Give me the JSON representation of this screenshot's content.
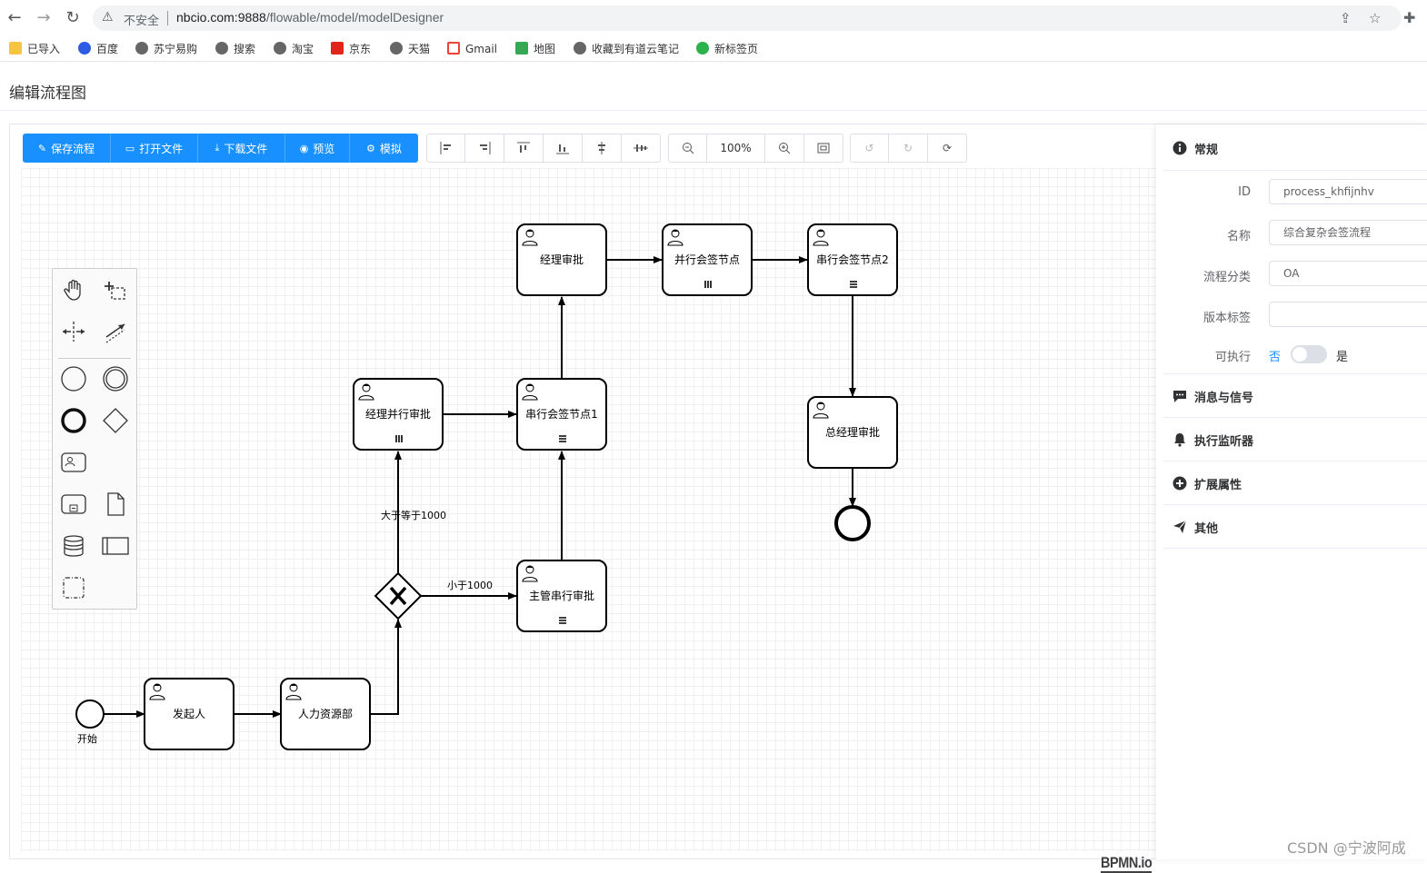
{
  "browser": {
    "insecure_label": "不安全",
    "url_host": "nbcio.com:9888",
    "url_path": "/flowable/model/modelDesigner"
  },
  "bookmarks": [
    "已导入",
    "百度",
    "苏宁易购",
    "搜索",
    "淘宝",
    "京东",
    "天猫",
    "Gmail",
    "地图",
    "收藏到有道云笔记",
    "新标签页"
  ],
  "page": {
    "title": "编辑流程图"
  },
  "toolbar": {
    "primary": [
      "保存流程",
      "打开文件",
      "下载文件",
      "预览",
      "模拟"
    ],
    "zoom": "100%"
  },
  "diagram": {
    "start_label": "开始",
    "tasks": {
      "initiator": "发起人",
      "hr": "人力资源部",
      "manager_parallel": "经理并行审批",
      "serial_sign1": "串行会签节点1",
      "supervisor_serial": "主管串行审批",
      "manager_approve": "经理审批",
      "parallel_sign": "并行会签节点",
      "serial_sign2": "串行会签节点2",
      "gm_approve": "总经理审批"
    },
    "flows": {
      "ge1000": "大于等于1000",
      "lt1000": "小于1000"
    },
    "logo": "BPMN.io"
  },
  "properties": {
    "general": {
      "header": "常规",
      "id_label": "ID",
      "id_value": "process_khfijnhv",
      "name_label": "名称",
      "name_value": "综合复杂会签流程",
      "category_label": "流程分类",
      "category_value": "OA",
      "version_label": "版本标签",
      "version_value": "",
      "executable_label": "可执行",
      "executable_no": "否",
      "executable_yes": "是"
    },
    "sections": [
      "消息与信号",
      "执行监听器",
      "扩展属性",
      "其他"
    ]
  },
  "watermark": "CSDN @宁波阿成"
}
